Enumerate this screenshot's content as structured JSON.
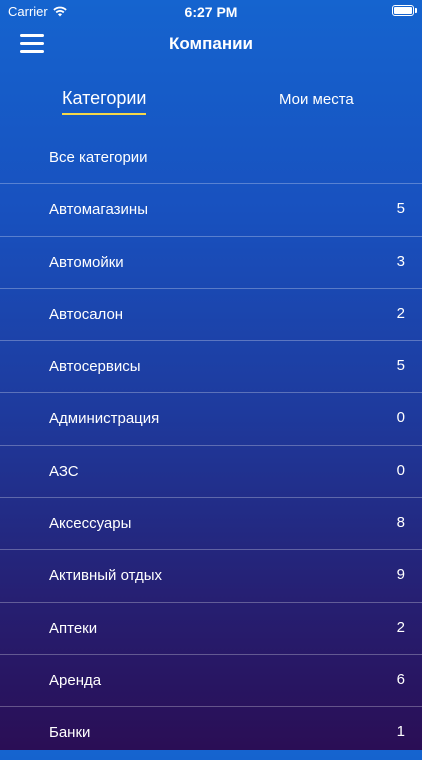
{
  "status_bar": {
    "carrier": "Carrier",
    "time": "6:27 PM"
  },
  "nav": {
    "title": "Компании",
    "menu_icon": "hamburger-menu-icon"
  },
  "tabs": [
    {
      "label": "Категории",
      "active": true
    },
    {
      "label": "Мои места",
      "active": false
    }
  ],
  "categories": [
    {
      "label": "Все категории",
      "count": ""
    },
    {
      "label": "Автомагазины",
      "count": "5"
    },
    {
      "label": "Автомойки",
      "count": "3"
    },
    {
      "label": "Автосалон",
      "count": "2"
    },
    {
      "label": "Автосервисы",
      "count": "5"
    },
    {
      "label": "Администрация",
      "count": "0"
    },
    {
      "label": "АЗС",
      "count": "0"
    },
    {
      "label": "Аксессуары",
      "count": "8"
    },
    {
      "label": "Активный отдых",
      "count": "9"
    },
    {
      "label": "Аптеки",
      "count": "2"
    },
    {
      "label": "Аренда",
      "count": "6"
    },
    {
      "label": "Банки",
      "count": "1"
    }
  ],
  "colors": {
    "accent_underline": "#f5d84a",
    "gradient_top": "#1564cf",
    "gradient_bottom": "#2a0e55"
  }
}
